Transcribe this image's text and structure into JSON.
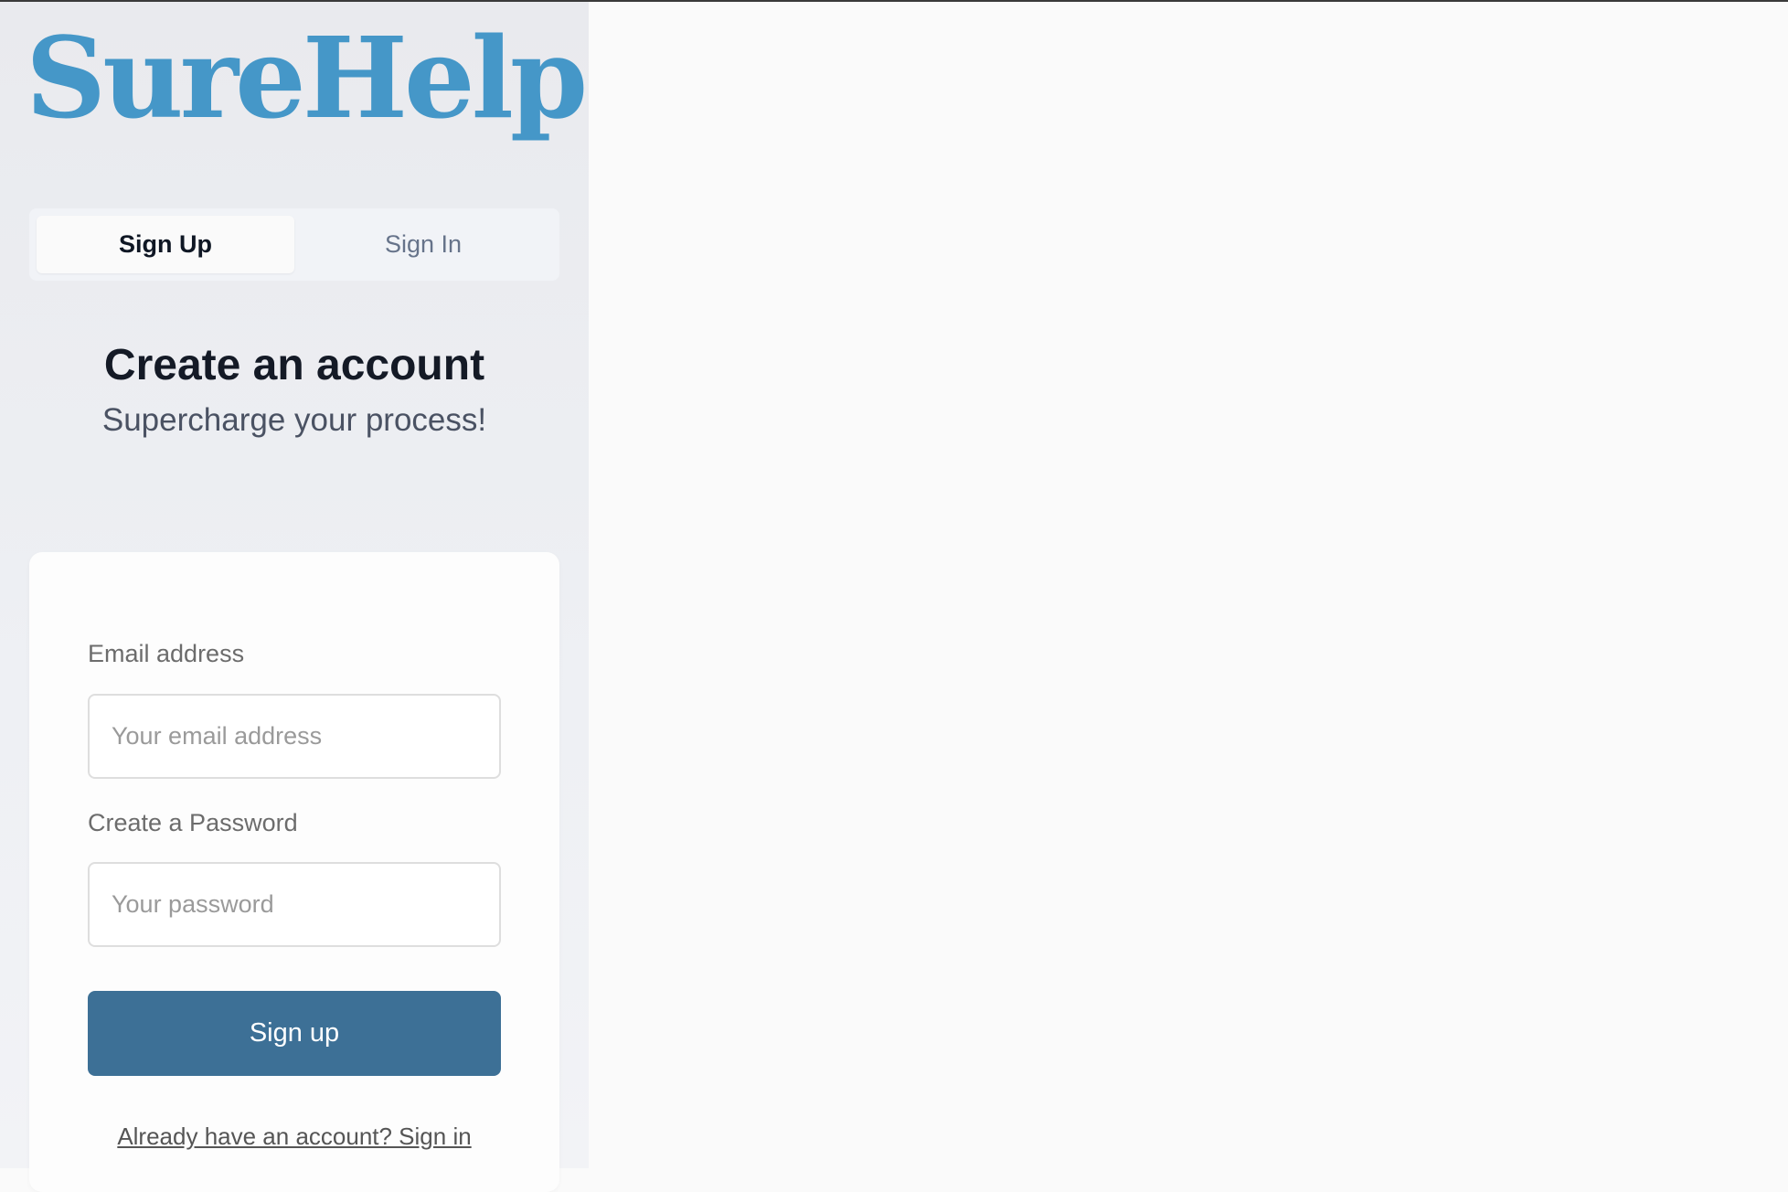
{
  "brand": {
    "logo_text": "SureHelp",
    "logo_color": "#4597c8"
  },
  "tabs": [
    {
      "label": "Sign Up",
      "active": true
    },
    {
      "label": "Sign In",
      "active": false
    }
  ],
  "hero": {
    "title": "Create an account",
    "subtitle": "Supercharge your process!"
  },
  "form": {
    "email_label": "Email address",
    "email_placeholder": "Your email address",
    "email_value": "",
    "password_label": "Create a Password",
    "password_placeholder": "Your password",
    "password_value": "",
    "submit_label": "Sign up",
    "submit_color": "#3d7096",
    "signin_link": "Already have an account? Sign in"
  }
}
